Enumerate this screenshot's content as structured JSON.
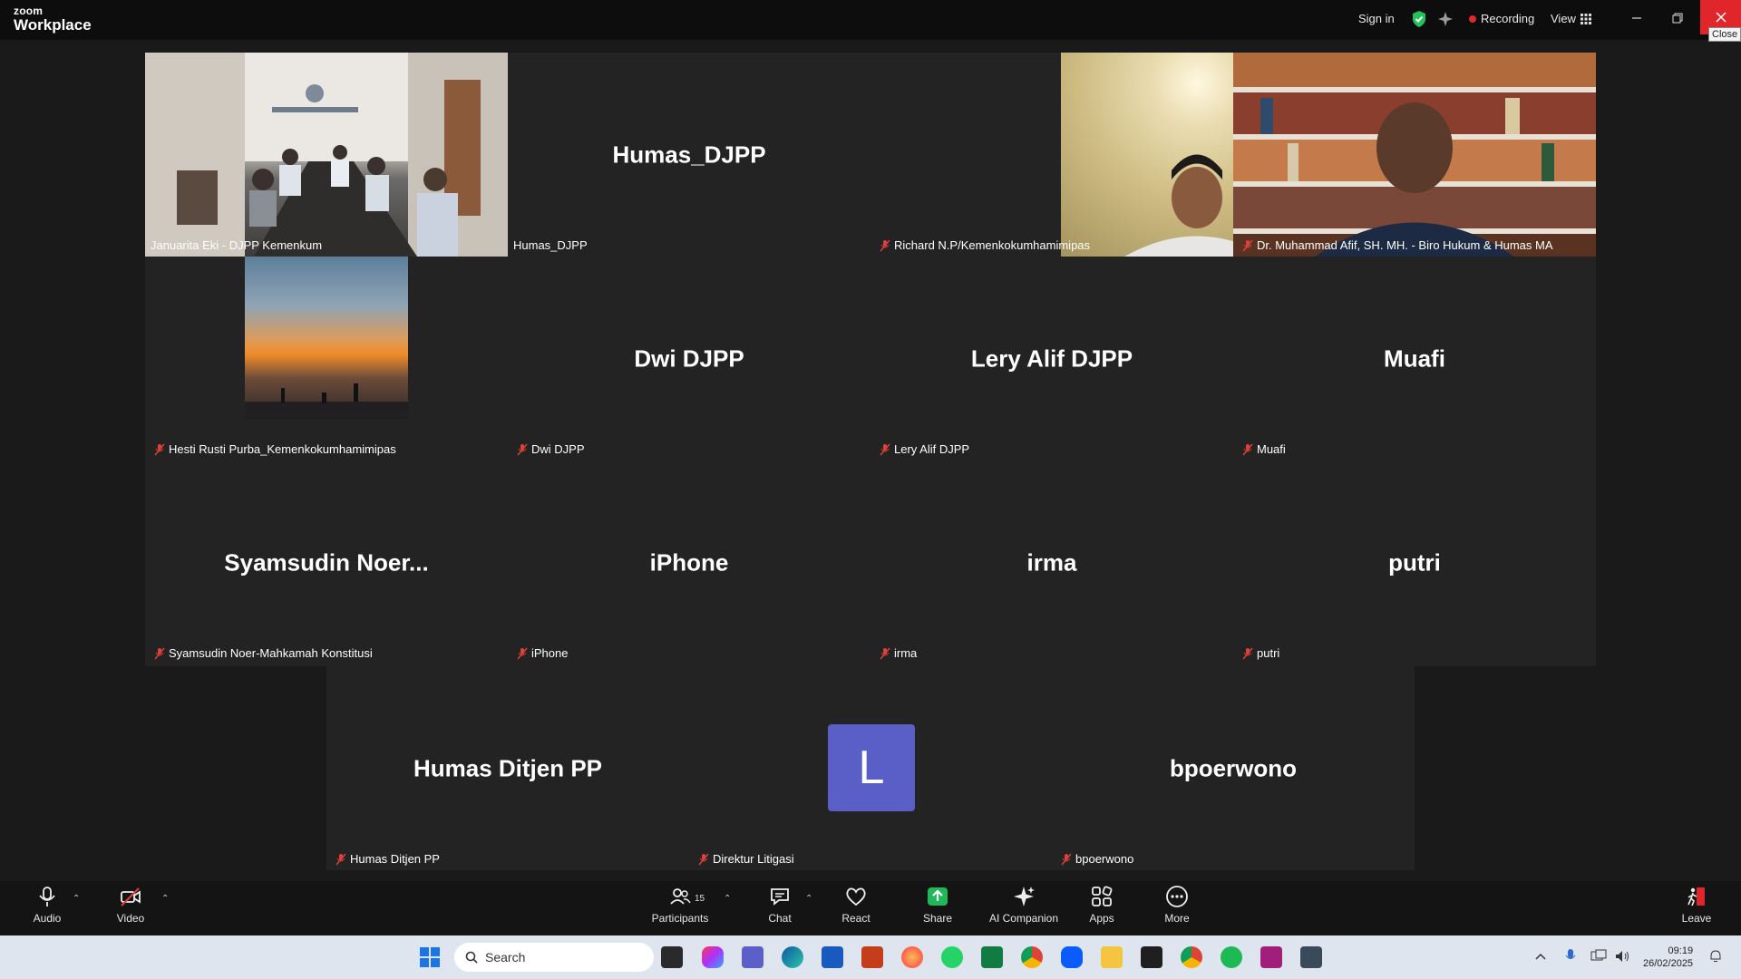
{
  "titlebar": {
    "logo_line1": "zoom",
    "logo_line2": "Workplace",
    "signin": "Sign in",
    "recording": "Recording",
    "view": "View",
    "close_tooltip": "Close"
  },
  "tiles": {
    "januarita": {
      "label": "Januarita Eki - DJPP Kemenkum"
    },
    "humas_djpp": {
      "name": "Humas_DJPP",
      "label": "Humas_DJPP"
    },
    "richard": {
      "label": "Richard N.P/Kemenkokumhamimipas"
    },
    "afif": {
      "label": "Dr. Muhammad Afif, SH. MH. - Biro Hukum & Humas MA"
    },
    "hesti": {
      "label": "Hesti Rusti Purba_Kemenkokumhamimipas"
    },
    "dwi": {
      "name": "Dwi DJPP",
      "label": "Dwi DJPP"
    },
    "lery": {
      "name": "Lery Alif DJPP",
      "label": "Lery Alif DJPP"
    },
    "muafi": {
      "name": "Muafi",
      "label": "Muafi"
    },
    "syamsudin": {
      "name": "Syamsudin  Noer...",
      "label": "Syamsudin Noer-Mahkamah Konstitusi"
    },
    "iphone": {
      "name": "iPhone",
      "label": "iPhone"
    },
    "irma": {
      "name": "irma",
      "label": "irma"
    },
    "putri": {
      "name": "putri",
      "label": "putri"
    },
    "humas_ditjen": {
      "name": "Humas Ditjen PP",
      "label": "Humas Ditjen PP"
    },
    "direktur": {
      "avatar": "L",
      "label": "Direktur Litigasi"
    },
    "bpoerwono": {
      "name": "bpoerwono",
      "label": "bpoerwono"
    }
  },
  "toolbar": {
    "audio": "Audio",
    "video": "Video",
    "participants": "Participants",
    "participants_count": "15",
    "chat": "Chat",
    "react": "React",
    "share": "Share",
    "ai_companion": "AI Companion",
    "apps": "Apps",
    "more": "More",
    "leave": "Leave"
  },
  "taskbar": {
    "search_placeholder": "Search",
    "time": "09:19",
    "date": "26/02/2025"
  },
  "colors": {
    "active_speaker": "#23d96b",
    "close_red": "#e0262b",
    "share_green": "#1fb95a",
    "avatar_purple": "#5a5fc7"
  }
}
